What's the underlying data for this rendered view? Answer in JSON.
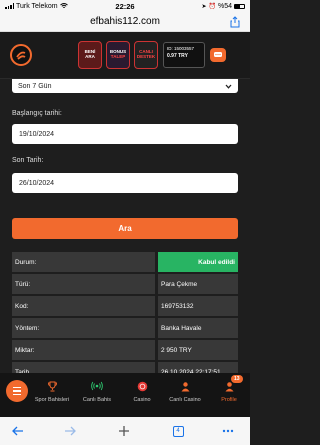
{
  "status_bar": {
    "carrier": "Turk Telekom",
    "time": "22:26",
    "battery": "%54"
  },
  "browser": {
    "url": "efbahis112.com",
    "tab_count": "4"
  },
  "header": {
    "btn_beni_ara_line1": "BENİ",
    "btn_beni_ara_line2": "ARA",
    "btn_bonus_line1": "BONUS",
    "btn_bonus_line2": "TALEP",
    "btn_canli_line1": "CANLI",
    "btn_canli_line2": "DESTEK",
    "account_id": "ID: 15003557",
    "balance": "0.97 TRY"
  },
  "filter": {
    "period_value": "Son 7 Gün",
    "start_label": "Başlangıç tarihi:",
    "start_value": "19/10/2024",
    "end_label": "Son Tarih:",
    "end_value": "26/10/2024",
    "search_label": "Ara"
  },
  "details": [
    {
      "label": "Durum:",
      "value": "Kabul edildi"
    },
    {
      "label": "Türü:",
      "value": "Para Çekme"
    },
    {
      "label": "Kod:",
      "value": "169753132"
    },
    {
      "label": "Yöntem:",
      "value": "Banka Havale"
    },
    {
      "label": "Miktar:",
      "value": "2 950 TRY"
    },
    {
      "label": "Tarih",
      "value": "26.10.2024 22:17:51"
    }
  ],
  "bottom_nav": {
    "sports": "Spor Bahisleri",
    "live": "Canlı Bahis",
    "casino": "Casino",
    "live_casino": "Canlı Casino",
    "profile": "Profile",
    "profile_badge": "13"
  },
  "colors": {
    "accent": "#f26a2e",
    "success": "#28b463",
    "row_bg": "#383838"
  }
}
